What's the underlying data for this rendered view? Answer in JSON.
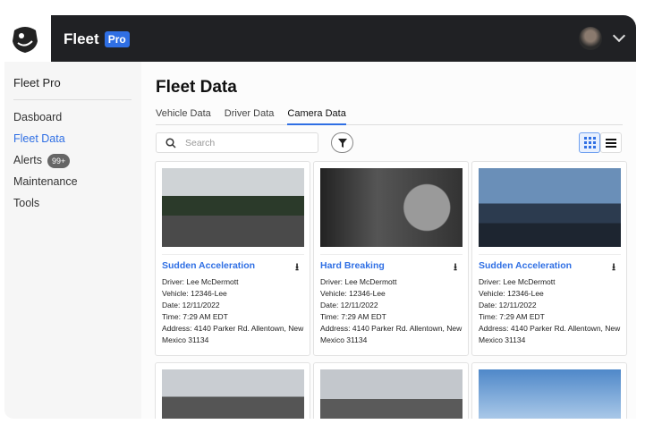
{
  "header": {
    "brand": "Fleet",
    "badge": "Pro"
  },
  "sidebar": {
    "title": "Fleet Pro",
    "items": [
      {
        "label": "Dasboard"
      },
      {
        "label": "Fleet Data"
      },
      {
        "label": "Alerts",
        "badge": "99+"
      },
      {
        "label": "Maintenance"
      },
      {
        "label": "Tools"
      }
    ]
  },
  "main": {
    "title": "Fleet Data",
    "tabs": [
      "Vehicle Data",
      "Driver Data",
      "Camera Data"
    ],
    "search_placeholder": "Search",
    "cards": [
      {
        "title": "Sudden Acceleration",
        "driver": "Driver: Lee McDermott",
        "vehicle": "Vehicle: 12346-Lee",
        "date": "Date: 12/11/2022",
        "time": "Time: 7:29 AM EDT",
        "address": "Address: 4140 Parker Rd. Allentown, New Mexico 31134"
      },
      {
        "title": "Hard Breaking",
        "driver": "Driver: Lee McDermott",
        "vehicle": "Vehicle: 12346-Lee",
        "date": "Date: 12/11/2022",
        "time": "Time: 7:29 AM EDT",
        "address": "Address: 4140 Parker Rd. Allentown, New Mexico 31134"
      },
      {
        "title": "Sudden Acceleration",
        "driver": "Driver: Lee McDermott",
        "vehicle": "Vehicle: 12346-Lee",
        "date": "Date: 12/11/2022",
        "time": "Time: 7:29 AM EDT",
        "address": "Address: 4140 Parker Rd. Allentown, New Mexico 31134"
      }
    ]
  }
}
